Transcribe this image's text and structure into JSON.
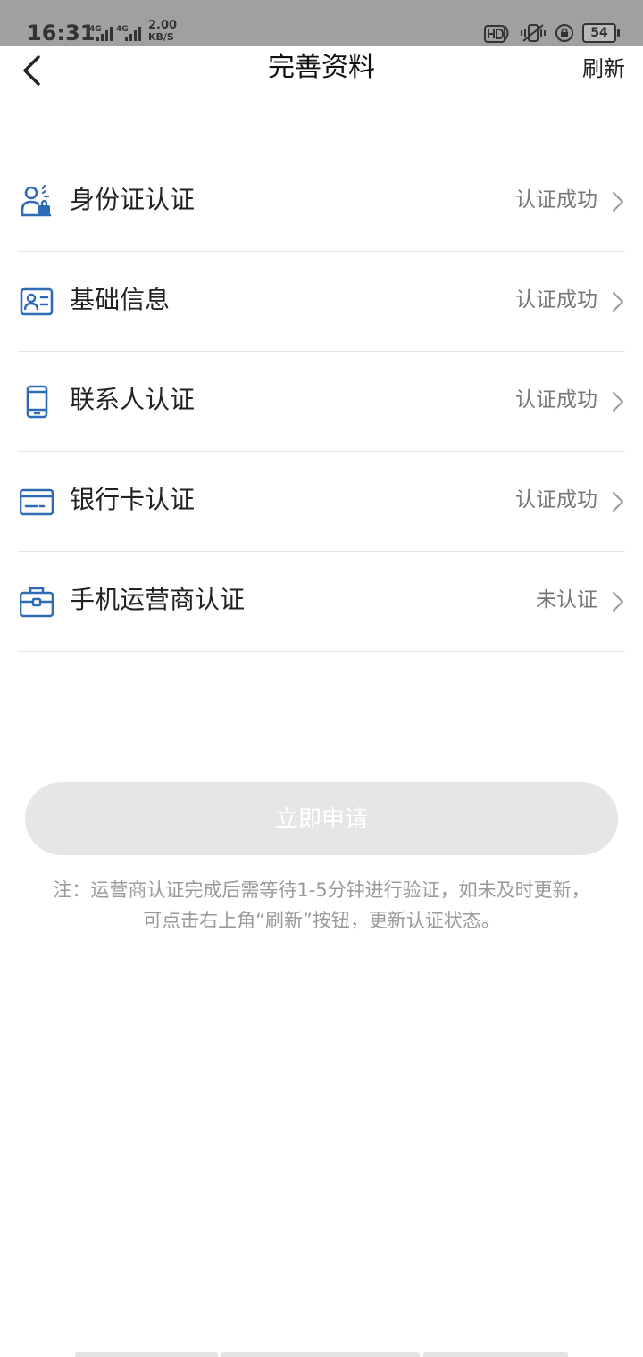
{
  "status_bar": {
    "time": "16:31",
    "network_1": "4G",
    "network_2": "4G",
    "speed_value": "2.00",
    "speed_unit": "KB/S",
    "battery": "54"
  },
  "nav": {
    "title": "完善资料",
    "refresh_label": "刷新",
    "back_icon": "chevron-left-icon"
  },
  "colors": {
    "accent": "#2f6ab7",
    "status_text": "#777777",
    "divider": "#e4e4e4",
    "button_disabled_bg": "#e6e6e6",
    "note_text": "#9a9a9a"
  },
  "items": [
    {
      "icon": "id-card-person-icon",
      "label": "身份证认证",
      "status": "认证成功"
    },
    {
      "icon": "profile-card-icon",
      "label": "基础信息",
      "status": "认证成功"
    },
    {
      "icon": "phone-icon",
      "label": "联系人认证",
      "status": "认证成功"
    },
    {
      "icon": "bank-card-icon",
      "label": "银行卡认证",
      "status": "认证成功"
    },
    {
      "icon": "briefcase-icon",
      "label": "手机运营商认证",
      "status": "未认证"
    }
  ],
  "apply_button": {
    "label": "立即申请",
    "enabled": false
  },
  "note": {
    "line1": "注：运营商认证完成后需等待1-5分钟进行验证，如未及时更新，",
    "line2": "可点击右上角“刷新”按钮，更新认证状态。"
  }
}
